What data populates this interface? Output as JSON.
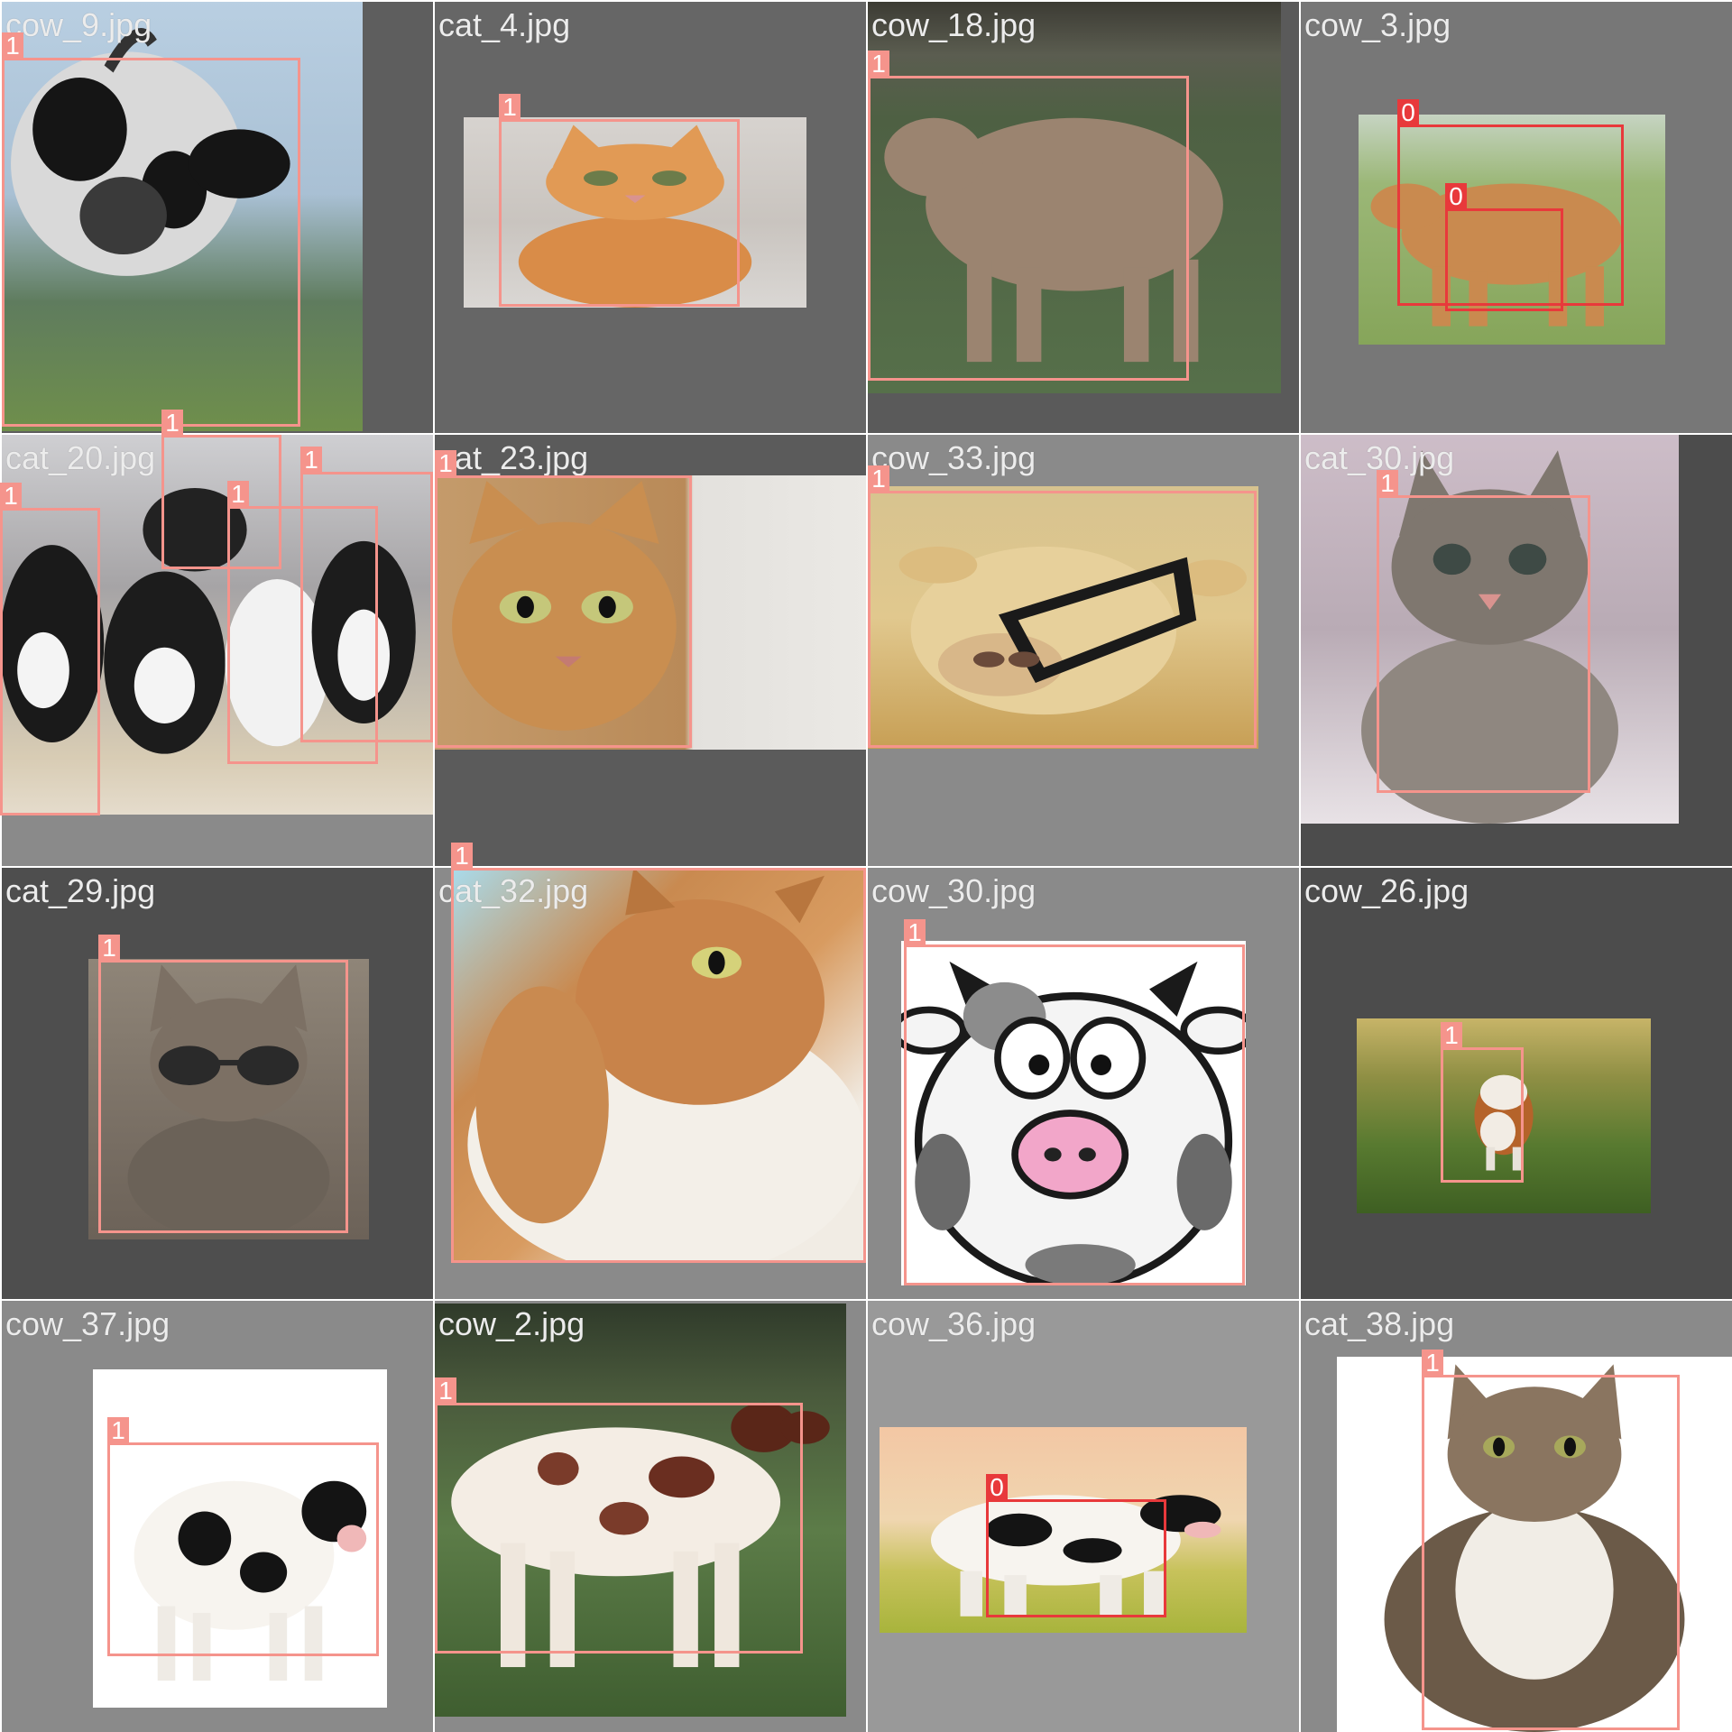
{
  "colors": {
    "class_0": "#e8393b",
    "class_1": "#f5948c",
    "padding_shades": [
      "#5e5e5e",
      "#777777",
      "#8a8a8a",
      "#666666",
      "#4c4c4c",
      "#999999"
    ]
  },
  "tiles": [
    {
      "name": "cow_9.jpg",
      "subject": "black-and-white cow close-up",
      "boxes": [
        {
          "label": "1"
        }
      ]
    },
    {
      "name": "cat_4.jpg",
      "subject": "orange tabby cat on bed",
      "boxes": [
        {
          "label": "1"
        }
      ]
    },
    {
      "name": "cow_18.jpg",
      "subject": "fluffy highland calf",
      "boxes": [
        {
          "label": "1"
        }
      ]
    },
    {
      "name": "cow_3.jpg",
      "subject": "cow with nursing calf",
      "boxes": [
        {
          "label": "0"
        },
        {
          "label": "0"
        }
      ]
    },
    {
      "name": "cat_20.jpg",
      "subject": "group of black-and-white kittens",
      "boxes": [
        {
          "label": "1"
        },
        {
          "label": "1"
        },
        {
          "label": "1"
        },
        {
          "label": "1"
        }
      ]
    },
    {
      "name": "cat_23.jpg",
      "subject": "bengal cat face",
      "boxes": [
        {
          "label": "1"
        }
      ]
    },
    {
      "name": "cow_33.jpg",
      "subject": "cream cow with halter",
      "boxes": [
        {
          "label": "1"
        }
      ]
    },
    {
      "name": "cat_30.jpg",
      "subject": "tabby kitten with yarn",
      "boxes": [
        {
          "label": "1"
        }
      ]
    },
    {
      "name": "cat_29.jpg",
      "subject": "cat wearing sunglasses",
      "boxes": [
        {
          "label": "1"
        }
      ]
    },
    {
      "name": "cat_32.jpg",
      "subject": "long-haired cat looking up",
      "boxes": [
        {
          "label": "1"
        }
      ]
    },
    {
      "name": "cow_30.jpg",
      "subject": "cartoon cow",
      "boxes": [
        {
          "label": "1"
        }
      ]
    },
    {
      "name": "cow_26.jpg",
      "subject": "brown-and-white calf in grass",
      "boxes": [
        {
          "label": "1"
        }
      ]
    },
    {
      "name": "cow_37.jpg",
      "subject": "toy holstein cow",
      "boxes": [
        {
          "label": "1"
        }
      ]
    },
    {
      "name": "cow_2.jpg",
      "subject": "spotted dairy cow in pasture",
      "boxes": [
        {
          "label": "1"
        }
      ]
    },
    {
      "name": "cow_36.jpg",
      "subject": "holstein cow in field",
      "boxes": [
        {
          "label": "0"
        }
      ]
    },
    {
      "name": "cat_38.jpg",
      "subject": "maine coon cat sitting",
      "boxes": [
        {
          "label": "1"
        }
      ]
    }
  ]
}
